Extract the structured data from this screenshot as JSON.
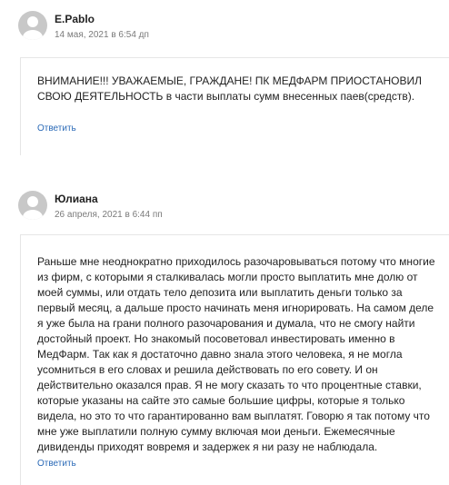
{
  "comments": [
    {
      "author": "E.Pablo",
      "date": "14 мая, 2021 в 6:54 дп",
      "text": "ВНИМАНИЕ!!! УВАЖАЕМЫЕ, ГРАЖДАНЕ! ПК МЕДФАРМ ПРИОСТАНОВИЛ СВОЮ ДЕЯТЕЛЬНОСТЬ в части выплаты сумм внесенных паев(средств).",
      "reply_label": "Ответить"
    },
    {
      "author": "Юлиана",
      "date": "26 апреля, 2021 в 6:44 пп",
      "text": "Раньше мне неоднократно приходилось разочаровываться потому что многие из фирм, с которыми я сталкивалась могли просто выплатить мне долю от моей суммы, или отдать тело депозита или выплатить деньги только за первый месяц, а дальше просто начинать меня игнорировать. На самом деле я уже была на грани полного разочарования и думала, что не смогу найти достойный проект. Но знакомый посоветовал инвестировать именно в МедФарм. Так как я достаточно давно знала этого человека, я не могла усомниться в его словах и решила действовать по его совету. И он действительно оказался прав. Я не могу сказать то что процентные ставки, которые указаны на сайте это самые большие цифры, которые я только видела, но это то что гарантированно вам выплатят. Говорю я так потому что мне уже выплатили полную сумму включая мои деньги. Ежемесячные дивиденды приходят вовремя и задержек я ни разу не наблюдала.",
      "reply_label": "Ответить"
    }
  ]
}
